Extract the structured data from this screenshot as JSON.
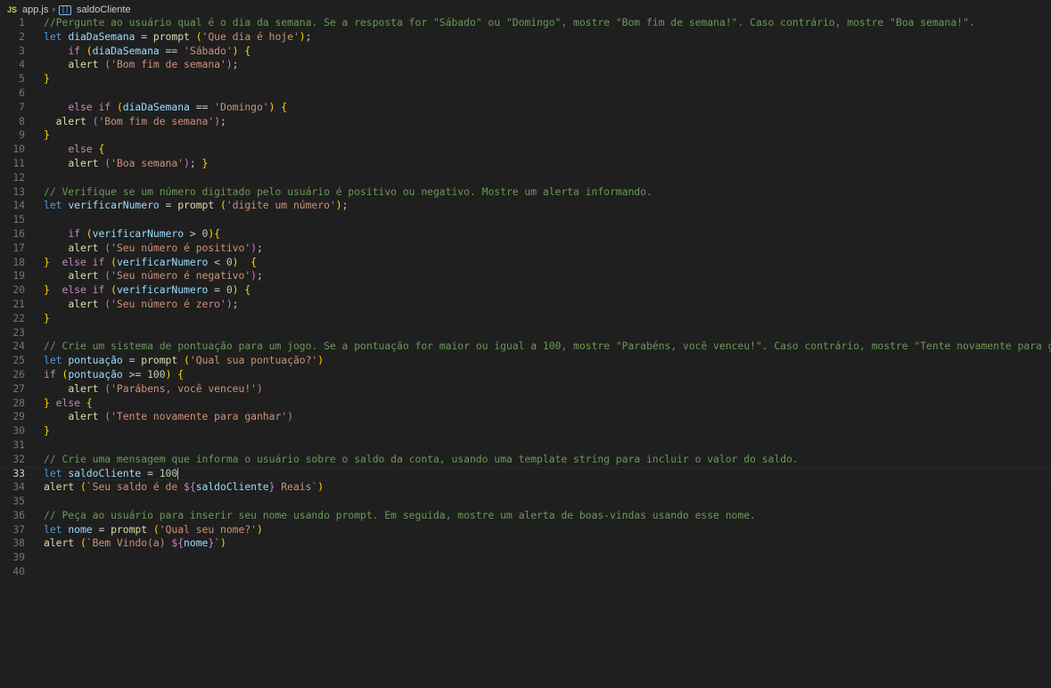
{
  "breadcrumb": {
    "file": "app.js",
    "file_icon": "JS",
    "symbol": "saldoCliente"
  },
  "lines": [
    {
      "n": "1",
      "tokens": [
        [
          "comment",
          "//Pergunte ao usuário qual é o dia da semana. Se a resposta for \"Sábado\" ou \"Domingo\", mostre \"Bom fim de semana!\". Caso contrário, mostre \"Boa semana!\"."
        ]
      ]
    },
    {
      "n": "2",
      "tokens": [
        [
          "keyword",
          "let"
        ],
        [
          "plain",
          " "
        ],
        [
          "var",
          "diaDaSemana"
        ],
        [
          "plain",
          " = "
        ],
        [
          "fn",
          "prompt"
        ],
        [
          "plain",
          " "
        ],
        [
          "p1",
          "("
        ],
        [
          "string",
          "'Que dia é hoje'"
        ],
        [
          "p1",
          ")"
        ],
        [
          "plain",
          ";"
        ]
      ]
    },
    {
      "n": "3",
      "tokens": [
        [
          "plain",
          "    "
        ],
        [
          "control",
          "if"
        ],
        [
          "plain",
          " "
        ],
        [
          "p1",
          "("
        ],
        [
          "var",
          "diaDaSemana"
        ],
        [
          "plain",
          " == "
        ],
        [
          "string",
          "'Sábado'"
        ],
        [
          "p1",
          ")"
        ],
        [
          "plain",
          " "
        ],
        [
          "p1",
          "{"
        ]
      ]
    },
    {
      "n": "4",
      "tokens": [
        [
          "plain",
          "    "
        ],
        [
          "fn",
          "alert"
        ],
        [
          "plain",
          " "
        ],
        [
          "p2",
          "("
        ],
        [
          "string",
          "'Bom fim de semana'"
        ],
        [
          "p2",
          ")"
        ],
        [
          "plain",
          ";"
        ]
      ]
    },
    {
      "n": "5",
      "tokens": [
        [
          "p1",
          "}"
        ]
      ]
    },
    {
      "n": "6",
      "tokens": []
    },
    {
      "n": "7",
      "tokens": [
        [
          "plain",
          "    "
        ],
        [
          "control",
          "else"
        ],
        [
          "plain",
          " "
        ],
        [
          "control",
          "if"
        ],
        [
          "plain",
          " "
        ],
        [
          "p1",
          "("
        ],
        [
          "var",
          "diaDaSemana"
        ],
        [
          "plain",
          " == "
        ],
        [
          "string",
          "'Domingo'"
        ],
        [
          "p1",
          ")"
        ],
        [
          "plain",
          " "
        ],
        [
          "p1",
          "{"
        ]
      ]
    },
    {
      "n": "8",
      "tokens": [
        [
          "plain",
          "  "
        ],
        [
          "fn",
          "alert"
        ],
        [
          "plain",
          " "
        ],
        [
          "p2",
          "("
        ],
        [
          "string",
          "'Bom fim de semana'"
        ],
        [
          "p2",
          ")"
        ],
        [
          "plain",
          ";"
        ]
      ]
    },
    {
      "n": "9",
      "tokens": [
        [
          "p1",
          "}"
        ]
      ]
    },
    {
      "n": "10",
      "tokens": [
        [
          "plain",
          "    "
        ],
        [
          "control",
          "else"
        ],
        [
          "plain",
          " "
        ],
        [
          "p1",
          "{"
        ]
      ]
    },
    {
      "n": "11",
      "tokens": [
        [
          "plain",
          "    "
        ],
        [
          "fn",
          "alert"
        ],
        [
          "plain",
          " "
        ],
        [
          "p2",
          "("
        ],
        [
          "string",
          "'Boa semana'"
        ],
        [
          "p2",
          ")"
        ],
        [
          "plain",
          "; "
        ],
        [
          "p1",
          "}"
        ]
      ]
    },
    {
      "n": "12",
      "tokens": []
    },
    {
      "n": "13",
      "tokens": [
        [
          "comment",
          "// Verifique se um número digitado pelo usuário é positivo ou negativo. Mostre um alerta informando."
        ]
      ]
    },
    {
      "n": "14",
      "tokens": [
        [
          "keyword",
          "let"
        ],
        [
          "plain",
          " "
        ],
        [
          "var",
          "verificarNumero"
        ],
        [
          "plain",
          " = "
        ],
        [
          "fn",
          "prompt"
        ],
        [
          "plain",
          " "
        ],
        [
          "p1",
          "("
        ],
        [
          "string",
          "'digite um número'"
        ],
        [
          "p1",
          ")"
        ],
        [
          "plain",
          ";"
        ]
      ]
    },
    {
      "n": "15",
      "tokens": []
    },
    {
      "n": "16",
      "tokens": [
        [
          "plain",
          "    "
        ],
        [
          "control",
          "if"
        ],
        [
          "plain",
          " "
        ],
        [
          "p1",
          "("
        ],
        [
          "var",
          "verificarNumero"
        ],
        [
          "plain",
          " > "
        ],
        [
          "num",
          "0"
        ],
        [
          "p1",
          ")"
        ],
        [
          "p1",
          "{"
        ]
      ]
    },
    {
      "n": "17",
      "tokens": [
        [
          "plain",
          "    "
        ],
        [
          "fn",
          "alert"
        ],
        [
          "plain",
          " "
        ],
        [
          "p2",
          "("
        ],
        [
          "string",
          "'Seu número é positivo'"
        ],
        [
          "p2",
          ")"
        ],
        [
          "plain",
          ";"
        ]
      ]
    },
    {
      "n": "18",
      "tokens": [
        [
          "p1",
          "}"
        ],
        [
          "plain",
          "  "
        ],
        [
          "control",
          "else"
        ],
        [
          "plain",
          " "
        ],
        [
          "control",
          "if"
        ],
        [
          "plain",
          " "
        ],
        [
          "p1",
          "("
        ],
        [
          "var",
          "verificarNumero"
        ],
        [
          "plain",
          " < "
        ],
        [
          "num",
          "0"
        ],
        [
          "p1",
          ")"
        ],
        [
          "plain",
          "  "
        ],
        [
          "p1",
          "{"
        ]
      ]
    },
    {
      "n": "19",
      "tokens": [
        [
          "plain",
          "    "
        ],
        [
          "fn",
          "alert"
        ],
        [
          "plain",
          " "
        ],
        [
          "p2",
          "("
        ],
        [
          "string",
          "'Seu número é negativo'"
        ],
        [
          "p2",
          ")"
        ],
        [
          "plain",
          ";"
        ]
      ]
    },
    {
      "n": "20",
      "tokens": [
        [
          "p1",
          "}"
        ],
        [
          "plain",
          "  "
        ],
        [
          "control",
          "else"
        ],
        [
          "plain",
          " "
        ],
        [
          "control",
          "if"
        ],
        [
          "plain",
          " "
        ],
        [
          "p1",
          "("
        ],
        [
          "var",
          "verificarNumero"
        ],
        [
          "plain",
          " = "
        ],
        [
          "num",
          "0"
        ],
        [
          "p1",
          ")"
        ],
        [
          "plain",
          " "
        ],
        [
          "p1",
          "{"
        ]
      ]
    },
    {
      "n": "21",
      "tokens": [
        [
          "plain",
          "    "
        ],
        [
          "fn",
          "alert"
        ],
        [
          "plain",
          " "
        ],
        [
          "p2",
          "("
        ],
        [
          "string",
          "'Seu número é zero'"
        ],
        [
          "p2",
          ")"
        ],
        [
          "plain",
          ";"
        ]
      ]
    },
    {
      "n": "22",
      "tokens": [
        [
          "p1",
          "}"
        ]
      ]
    },
    {
      "n": "23",
      "tokens": []
    },
    {
      "n": "24",
      "tokens": [
        [
          "comment",
          "// Crie um sistema de pontuação para um jogo. Se a pontuação for maior ou igual a 100, mostre \"Parabéns, você venceu!\". Caso contrário, mostre \"Tente novamente para ganhar.\"."
        ]
      ]
    },
    {
      "n": "25",
      "tokens": [
        [
          "keyword",
          "let"
        ],
        [
          "plain",
          " "
        ],
        [
          "var",
          "pontuação"
        ],
        [
          "plain",
          " = "
        ],
        [
          "fn",
          "prompt"
        ],
        [
          "plain",
          " "
        ],
        [
          "p1",
          "("
        ],
        [
          "string",
          "'Qual sua pontuação?'"
        ],
        [
          "p1",
          ")"
        ]
      ]
    },
    {
      "n": "26",
      "tokens": [
        [
          "control",
          "if"
        ],
        [
          "plain",
          " "
        ],
        [
          "p1",
          "("
        ],
        [
          "var",
          "pontuação"
        ],
        [
          "plain",
          " >= "
        ],
        [
          "num",
          "100"
        ],
        [
          "p1",
          ")"
        ],
        [
          "plain",
          " "
        ],
        [
          "p1",
          "{"
        ]
      ]
    },
    {
      "n": "27",
      "tokens": [
        [
          "plain",
          "    "
        ],
        [
          "fn",
          "alert"
        ],
        [
          "plain",
          " "
        ],
        [
          "p2",
          "("
        ],
        [
          "string",
          "'Parábens, você venceu!'"
        ],
        [
          "p2",
          ")"
        ]
      ]
    },
    {
      "n": "28",
      "tokens": [
        [
          "p1",
          "}"
        ],
        [
          "plain",
          " "
        ],
        [
          "control",
          "else"
        ],
        [
          "plain",
          " "
        ],
        [
          "p1",
          "{"
        ]
      ]
    },
    {
      "n": "29",
      "tokens": [
        [
          "plain",
          "    "
        ],
        [
          "fn",
          "alert"
        ],
        [
          "plain",
          " "
        ],
        [
          "p2",
          "("
        ],
        [
          "string",
          "'Tente novamente para ganhar'"
        ],
        [
          "p2",
          ")"
        ]
      ]
    },
    {
      "n": "30",
      "tokens": [
        [
          "p1",
          "}"
        ]
      ]
    },
    {
      "n": "31",
      "tokens": []
    },
    {
      "n": "32",
      "tokens": [
        [
          "comment",
          "// Crie uma mensagem que informa o usuário sobre o saldo da conta, usando uma template string para incluir o valor do saldo."
        ]
      ]
    },
    {
      "n": "33",
      "current": true,
      "tokens": [
        [
          "keyword",
          "let"
        ],
        [
          "plain",
          " "
        ],
        [
          "var",
          "saldoCliente"
        ],
        [
          "plain",
          " = "
        ],
        [
          "num",
          "100"
        ]
      ]
    },
    {
      "n": "34",
      "tokens": [
        [
          "fn",
          "alert"
        ],
        [
          "plain",
          " "
        ],
        [
          "p1",
          "("
        ],
        [
          "string",
          "`Seu saldo é de "
        ],
        [
          "control",
          "${"
        ],
        [
          "var",
          "saldoCliente"
        ],
        [
          "control",
          "}"
        ],
        [
          "string",
          " Reais`"
        ],
        [
          "p1",
          ")"
        ]
      ]
    },
    {
      "n": "35",
      "tokens": []
    },
    {
      "n": "36",
      "tokens": [
        [
          "comment",
          "// Peça ao usuário para inserir seu nome usando prompt. Em seguida, mostre um alerta de boas-vindas usando esse nome."
        ]
      ]
    },
    {
      "n": "37",
      "tokens": [
        [
          "keyword",
          "let"
        ],
        [
          "plain",
          " "
        ],
        [
          "var",
          "nome"
        ],
        [
          "plain",
          " = "
        ],
        [
          "fn",
          "prompt"
        ],
        [
          "plain",
          " "
        ],
        [
          "p1",
          "("
        ],
        [
          "string",
          "'Qual seu nome?'"
        ],
        [
          "p1",
          ")"
        ]
      ]
    },
    {
      "n": "38",
      "tokens": [
        [
          "fn",
          "alert"
        ],
        [
          "plain",
          " "
        ],
        [
          "p1",
          "("
        ],
        [
          "string",
          "`Bem Vindo(a) "
        ],
        [
          "control",
          "${"
        ],
        [
          "var",
          "nome"
        ],
        [
          "control",
          "}"
        ],
        [
          "string",
          "`"
        ],
        [
          "p1",
          ")"
        ]
      ]
    },
    {
      "n": "39",
      "tokens": []
    },
    {
      "n": "40",
      "tokens": []
    }
  ]
}
